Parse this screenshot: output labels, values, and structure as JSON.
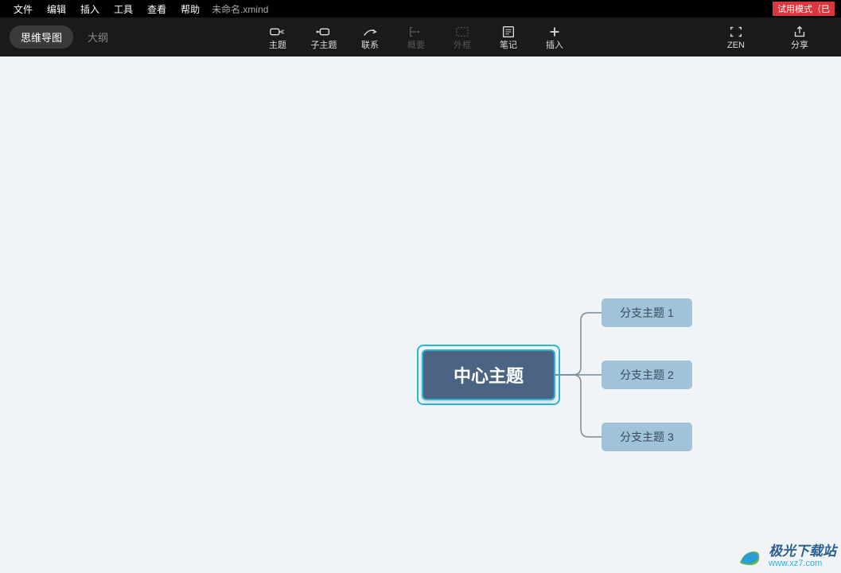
{
  "menu": {
    "items": [
      "文件",
      "编辑",
      "插入",
      "工具",
      "查看",
      "帮助"
    ],
    "doc_title": "未命名.xmind",
    "trial": "试用模式（已"
  },
  "view_tabs": {
    "mindmap": "思维导图",
    "outline": "大纲"
  },
  "tools": {
    "topic": "主题",
    "subtopic": "子主题",
    "relation": "联系",
    "summary": "概要",
    "boundary": "外框",
    "notes": "笔记",
    "insert": "插入",
    "zen": "ZEN",
    "share": "分享"
  },
  "mindmap": {
    "central": "中心主题",
    "branches": [
      "分支主题 1",
      "分支主题 2",
      "分支主题 3"
    ]
  },
  "watermark": {
    "title": "极光下载站",
    "url": "www.xz7.com"
  }
}
